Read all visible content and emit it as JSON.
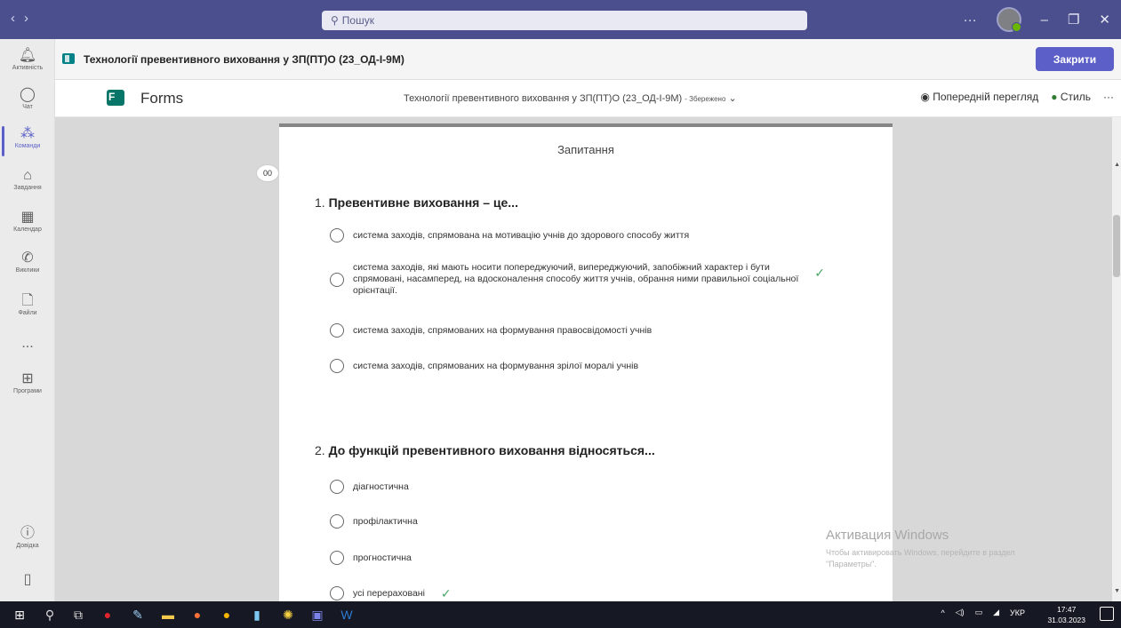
{
  "titlebar": {
    "search_placeholder": "Пошук",
    "more": "···",
    "window_controls": [
      "minimize",
      "maximize",
      "close"
    ]
  },
  "rail": {
    "items": [
      {
        "icon": "bell-icon",
        "label": "Активність"
      },
      {
        "icon": "chat-icon",
        "label": "Чат"
      },
      {
        "icon": "teams-icon",
        "label": "Команди",
        "active": true
      },
      {
        "icon": "assignments-icon",
        "label": "Завдання"
      },
      {
        "icon": "calendar-icon",
        "label": "Календар"
      },
      {
        "icon": "phone-icon",
        "label": "Виклики"
      },
      {
        "icon": "file-icon",
        "label": "Файли"
      },
      {
        "icon": "more-icon",
        "label": "..."
      },
      {
        "icon": "apps-icon",
        "label": "Програми"
      }
    ],
    "help_label": "Довідка"
  },
  "tab": {
    "title": "Технології превентивного виховання у ЗП(ПТ)О (23_ОД-І-9М)",
    "close_label": "Закрити"
  },
  "forms": {
    "app_name": "Forms",
    "doc_title": "Технології превентивного виховання у ЗП(ПТ)О (23_ОД-І-9М)",
    "saved": "Збережено",
    "preview": "Попередній перегляд",
    "style": "Стиль",
    "more": "···"
  },
  "content": {
    "header": "Запитання",
    "questions": [
      {
        "number": "1.",
        "text": "Превентивне виховання – це...",
        "options": [
          {
            "text": "система заходів, спрямована на мотивацію учнів до здорового способу життя",
            "correct": false
          },
          {
            "line1": "система заходів, які мають носити попереджуючий, випереджуючий, запобіжний характер і бути",
            "line2": "спрямовані, насамперед, на вдосконалення способу життя учнів, обрання ними правильної соціальної",
            "line3": "орієнтації.",
            "correct": true
          },
          {
            "text": "система заходів, спрямованих на формування правосвідомості учнів",
            "correct": false
          },
          {
            "text": "система заходів, спрямованих на формування зрілої моралі учнів",
            "correct": false
          }
        ]
      },
      {
        "number": "2.",
        "text": "До функцій превентивного виховання відносяться...",
        "options": [
          {
            "text": "діагностична",
            "correct": false
          },
          {
            "text": "профілактична",
            "correct": false
          },
          {
            "text": "прогностична",
            "correct": false
          },
          {
            "text": "усі перераховані",
            "correct": true
          }
        ]
      }
    ],
    "collapse_label": "00"
  },
  "watermark": {
    "title": "Активация Windows",
    "line1": "Чтобы активировать Windows, перейдите в раздел",
    "line2": "\"Параметры\"."
  },
  "taskbar": {
    "lang": "УКР",
    "time": "17:47",
    "date": "31.03.2023"
  },
  "colors": {
    "teams_purple": "#4b4f8e",
    "accent": "#5b5fc7",
    "check_green": "#4aa564"
  }
}
